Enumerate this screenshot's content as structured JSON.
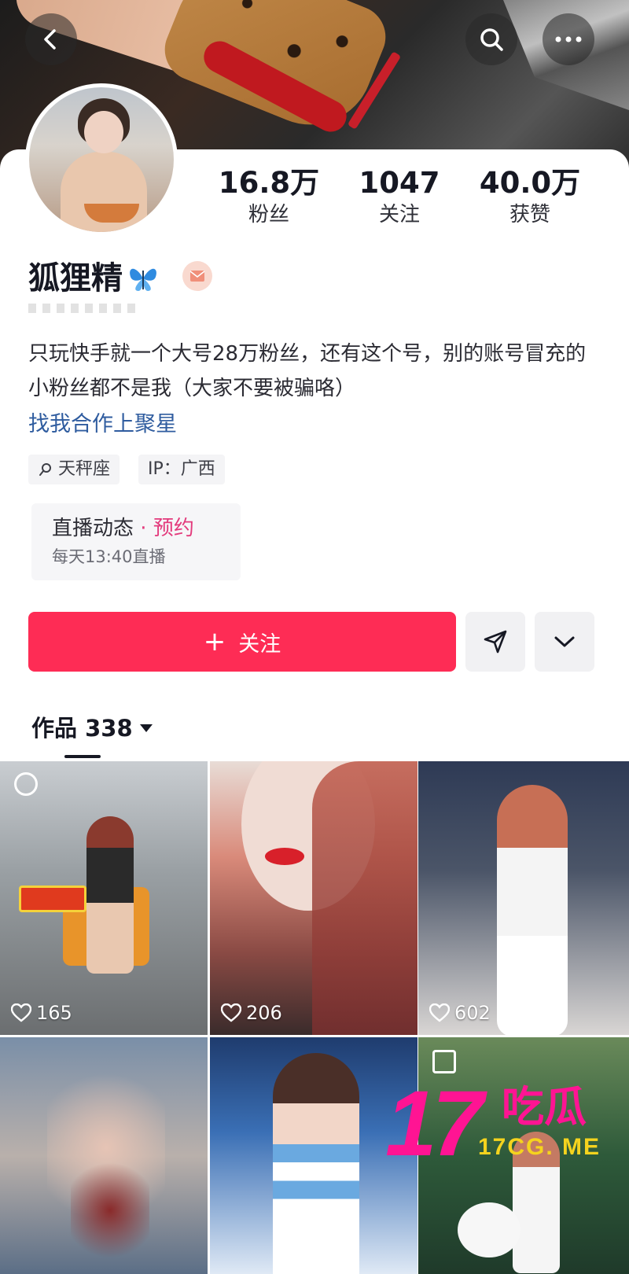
{
  "topbar": {
    "back_icon": "chevron-left-icon",
    "search_icon": "search-icon",
    "more_icon": "more-horizontal-icon"
  },
  "profile": {
    "nickname": "狐狸精",
    "nickname_emoji": "butterfly-icon",
    "stats": [
      {
        "value": "16.8万",
        "label": "粉丝"
      },
      {
        "value": "1047",
        "label": "关注"
      },
      {
        "value": "40.0万",
        "label": "获赞"
      }
    ],
    "bio": "只玩快手就一个大号28万粉丝，还有这个号，别的账号冒充的小粉丝都不是我（大家不要被骗咯）",
    "bio_link": "找我合作上聚星",
    "tags": [
      "天秤座",
      "IP：广西"
    ],
    "live": {
      "title": "直播动态",
      "separator": " · ",
      "action": "预约",
      "schedule": "每天13:40直播"
    }
  },
  "actions": {
    "follow_label": "关注",
    "share_icon": "send-icon",
    "dropdown_icon": "chevron-down-icon"
  },
  "works": {
    "tab_label": "作品 338",
    "items": [
      {
        "likes": "165"
      },
      {
        "likes": "206"
      },
      {
        "likes": "602"
      },
      {
        "likes": ""
      },
      {
        "likes": ""
      },
      {
        "likes": ""
      }
    ]
  },
  "watermark": {
    "number": "17",
    "text": "吃瓜",
    "url": "17CG. ME"
  },
  "colors": {
    "accent": "#fe2c55",
    "link": "#2f5c9f",
    "highlight": "#e33a7c",
    "watermark": "#ff1493"
  }
}
